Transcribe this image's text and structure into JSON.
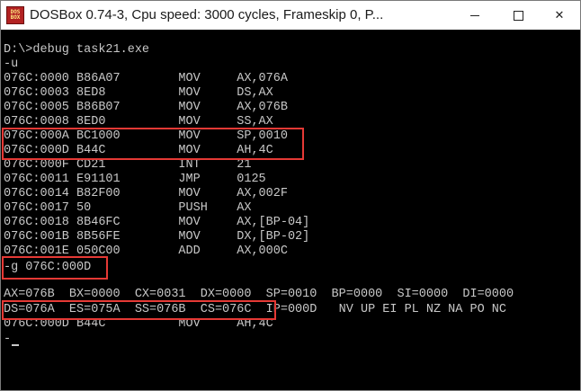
{
  "window": {
    "icon_text": "DOS\nBOX",
    "title": "DOSBox 0.74-3, Cpu speed:     3000 cycles, Frameskip  0, P...",
    "minimize_label": "",
    "maximize_label": "",
    "close_label": "✕"
  },
  "console": {
    "lines": [
      "D:\\>debug task21.exe",
      "-u",
      "076C:0000 B86A07        MOV     AX,076A",
      "076C:0003 8ED8          MOV     DS,AX",
      "076C:0005 B86B07        MOV     AX,076B",
      "076C:0008 8ED0          MOV     SS,AX",
      "076C:000A BC1000        MOV     SP,0010",
      "076C:000D B44C          MOV     AH,4C",
      "076C:000F CD21          INT     21",
      "076C:0011 E91101        JMP     0125",
      "076C:0014 B82F00        MOV     AX,002F",
      "076C:0017 50            PUSH    AX",
      "076C:0018 8B46FC        MOV     AX,[BP-04]",
      "076C:001B 8B56FE        MOV     DX,[BP-02]",
      "076C:001E 050C00        ADD     AX,000C",
      "-g 076C:000D",
      "",
      "AX=076B  BX=0000  CX=0031  DX=0000  SP=0010  BP=0000  SI=0000  DI=0000",
      "DS=076A  ES=075A  SS=076B  CS=076C  IP=000D   NV UP EI PL NZ NA PO NC",
      "076C:000D B44C          MOV     AH,4C",
      "-"
    ]
  },
  "colors": {
    "console_bg": "#000000",
    "console_text": "#c8c8c8",
    "highlight": "#e53935",
    "titlebar_bg": "#ffffff"
  }
}
